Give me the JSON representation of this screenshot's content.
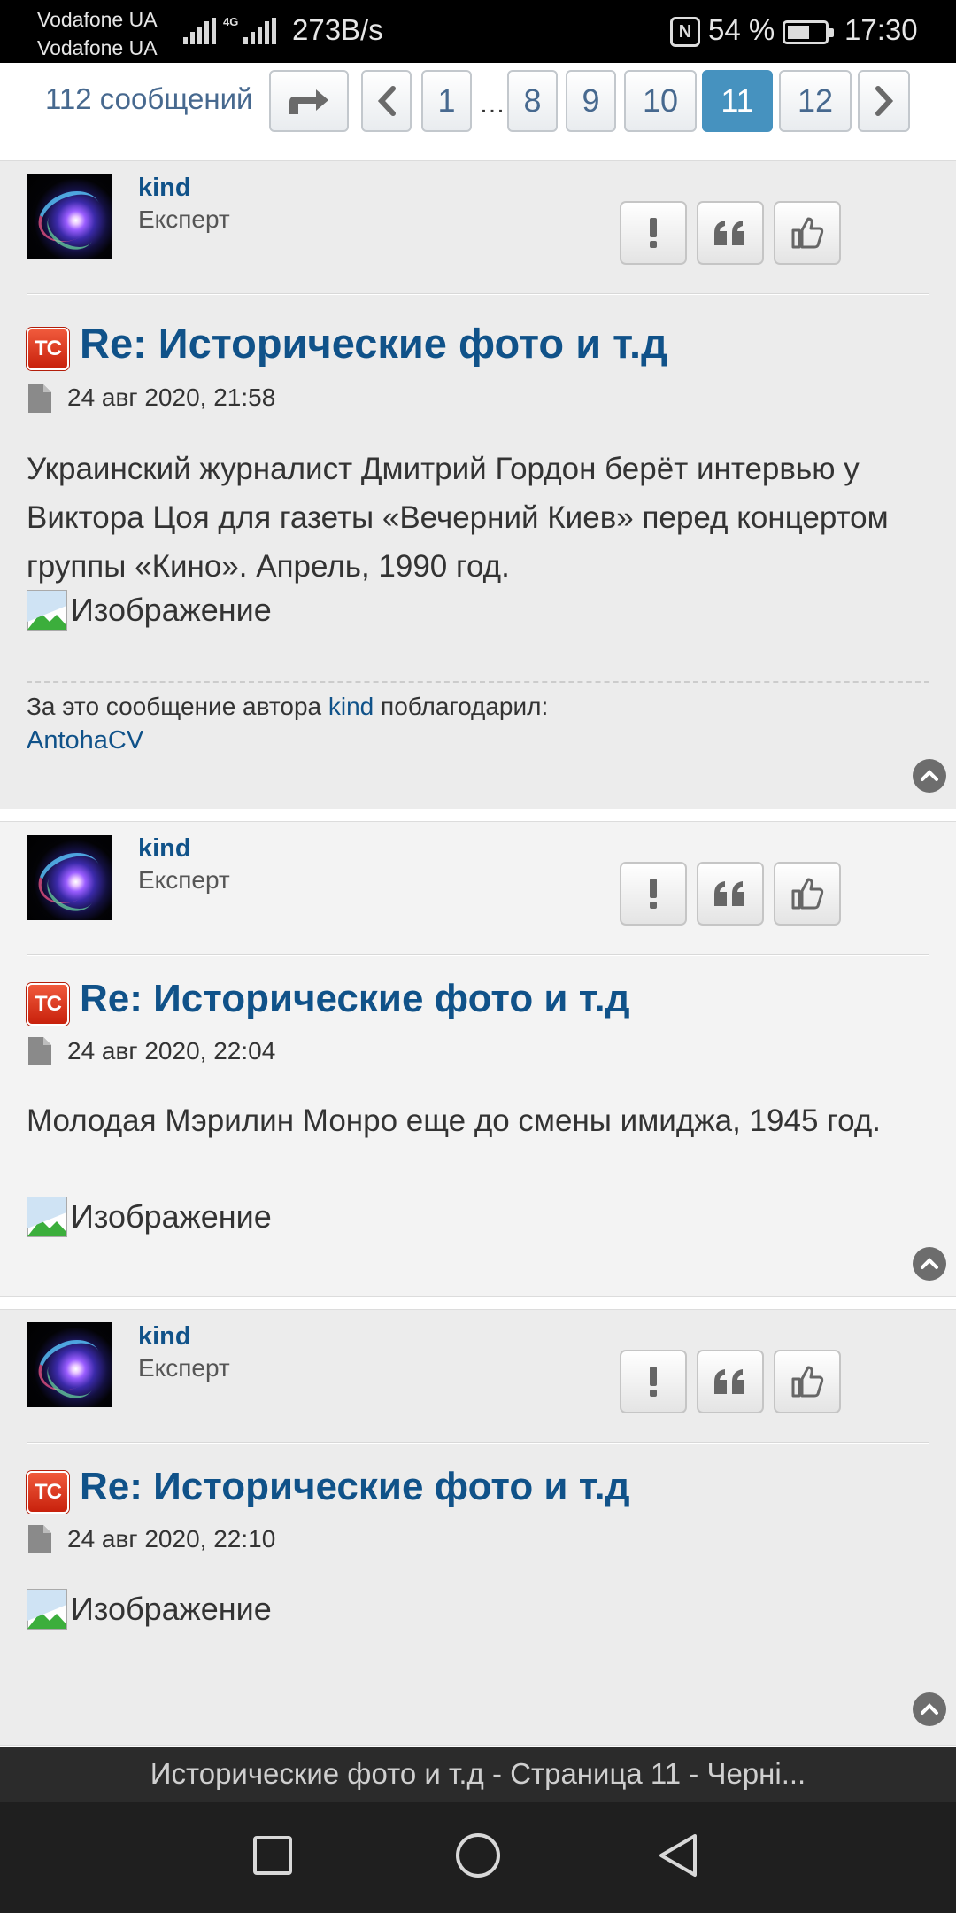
{
  "status_bar": {
    "carrier_1": "Vodafone UA",
    "carrier_2": "Vodafone UA",
    "network_type": "4G",
    "speed": "273B/s",
    "battery_percent": "54 %",
    "time": "17:30",
    "icons": [
      "signal-icon",
      "signal-icon",
      "nfc-icon",
      "battery-icon"
    ]
  },
  "pagination": {
    "message_count": "112 сообщений",
    "pages": [
      "1",
      "8",
      "9",
      "10",
      "11",
      "12"
    ],
    "ellipsis": "…",
    "current_page": "11"
  },
  "posts": [
    {
      "author": "kind",
      "rank": "Експерт",
      "title": "Re: Исторические фото и т.д",
      "topic_badge": "TC",
      "date": "24 авг 2020, 21:58",
      "body": "Украинский журналист Дмитрий Гордон берёт интервью у Виктора Цоя для газеты «Вечерний Киев» перед концертом группы «Кино». Апрель, 1990 год.",
      "image_alt": "Изображение",
      "thanks_prefix": "За это сообщение автора",
      "thanks_author": "kind",
      "thanks_suffix": "поблагодарил:",
      "thanks_user": "AntohaCV"
    },
    {
      "author": "kind",
      "rank": "Експерт",
      "title": "Re: Исторические фото и т.д",
      "topic_badge": "TC",
      "date": "24 авг 2020, 22:04",
      "body": "Молодая Мэрилин Монро еще до смены имиджа, 1945 год.",
      "image_alt": "Изображение"
    },
    {
      "author": "kind",
      "rank": "Експерт",
      "title": "Re: Исторические фото и т.д",
      "topic_badge": "TC",
      "date": "24 авг 2020, 22:10",
      "body": "",
      "image_alt": "Изображение"
    }
  ],
  "page_title": "Исторические фото и т.д - Страница 11 - Черні...",
  "colors": {
    "link": "#105289",
    "active_page": "#4692bf",
    "post_bg": "#ececec",
    "post_bg_alt": "#f3f3f3",
    "badge": "#d9321a"
  }
}
